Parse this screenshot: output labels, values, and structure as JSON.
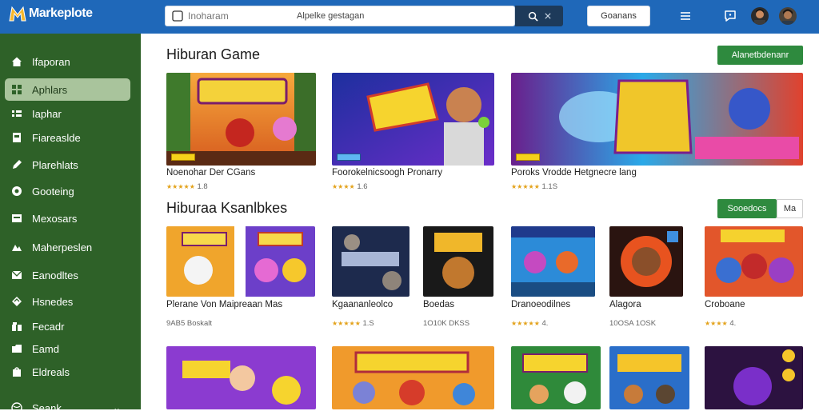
{
  "app": {
    "logo_text": "Markeplote"
  },
  "header": {
    "search_placeholder": "Inoharam",
    "search_hint": "Alpelke gestagan",
    "right_button": "Goanans"
  },
  "sidebar": {
    "items": [
      {
        "label": "Ifaporan",
        "icon": "home-icon"
      },
      {
        "label": "Aphlars",
        "icon": "apps-icon"
      },
      {
        "label": "Iaphar",
        "icon": "list-icon"
      },
      {
        "label": "Fiareaslde",
        "icon": "store-icon"
      },
      {
        "label": "Plarehlats",
        "icon": "pen-icon"
      },
      {
        "label": "Gooteing",
        "icon": "settings-icon"
      },
      {
        "label": "Mexosars",
        "icon": "window-icon"
      },
      {
        "label": "Maherpeslen",
        "icon": "people-icon"
      },
      {
        "label": "Eanodltes",
        "icon": "mail-icon"
      },
      {
        "label": "Hsnedes",
        "icon": "bookmark-icon"
      },
      {
        "label": "Fecadr",
        "icon": "gift-icon"
      },
      {
        "label": "Eamd",
        "icon": "folder-icon"
      },
      {
        "label": "Eldreals",
        "icon": "bag-icon"
      },
      {
        "label": "Seank",
        "icon": "globe-icon"
      }
    ]
  },
  "section1": {
    "title": "Hiburan Game",
    "button": "Alanetbdenanr",
    "cards": [
      {
        "title": "Noenohar Der CGans",
        "rating": "★★★★★",
        "meta": "1.8"
      },
      {
        "title": "Foorokelnicsoogh Pronarry",
        "rating": "★★★★",
        "meta": "1.6"
      },
      {
        "title": "Poroks Vrodde Hetgnecre lang",
        "rating": "★★★★★",
        "meta": "1.1S"
      }
    ]
  },
  "section2": {
    "title": "Hiburaa Ksanlbkes",
    "button": "Sooedocs",
    "ghost_button": "Ma",
    "cards": [
      {
        "title": "Plerane Von Maipreaan Mas",
        "rating": "",
        "meta": "9AB5 Boskalt"
      },
      {
        "title": "Kgaananleolco",
        "rating": "★★★★★",
        "meta": "1.S"
      },
      {
        "title": "Boedas",
        "rating": "",
        "meta": "1O10K DKSS"
      },
      {
        "title": "Dranoeodilnes",
        "rating": "★★★★★",
        "meta": "4."
      },
      {
        "title": "Alagora",
        "rating": "",
        "meta": "10OSA 1OSK"
      },
      {
        "title": "Croboane",
        "rating": "★★★★",
        "meta": "4."
      }
    ]
  },
  "colors": {
    "header": "#1f68b9",
    "sidebar": "#2e6128",
    "accent_green": "#2e8a3e"
  }
}
